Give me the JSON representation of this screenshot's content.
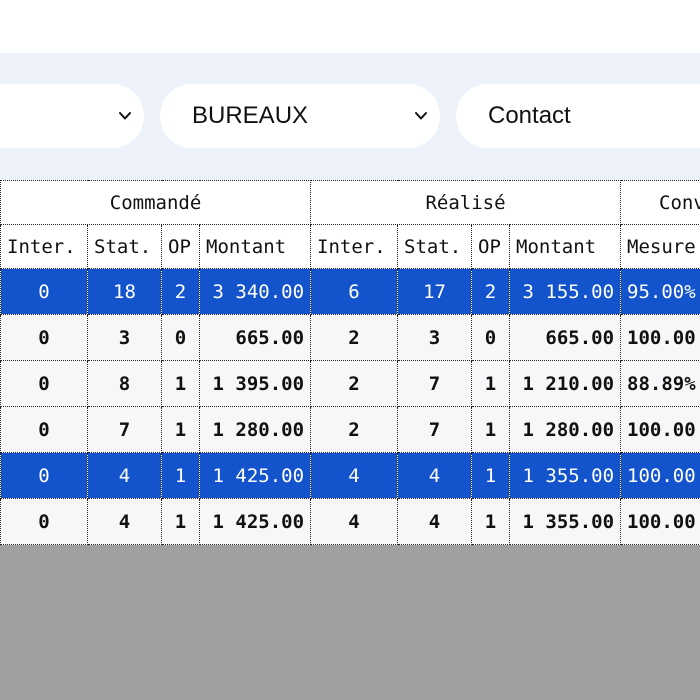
{
  "filters": {
    "first": {
      "value": ""
    },
    "second": {
      "value": "BUREAUX"
    },
    "third": {
      "value": "Contact"
    }
  },
  "table": {
    "groups": [
      "Commandé",
      "Réalisé",
      "Conv"
    ],
    "subheaders": [
      "Inter.",
      "Stat.",
      "OP",
      "Montant",
      "Inter.",
      "Stat.",
      "OP",
      "Montant",
      "Mesure"
    ],
    "rows": [
      {
        "selected": true,
        "cells": [
          "0",
          "18",
          "2",
          "3 340.00",
          "6",
          "17",
          "2",
          "3 155.00",
          "95.00%"
        ]
      },
      {
        "selected": false,
        "cells": [
          "0",
          "3",
          "0",
          "665.00",
          "2",
          "3",
          "0",
          "665.00",
          "100.00"
        ]
      },
      {
        "selected": false,
        "cells": [
          "0",
          "8",
          "1",
          "1 395.00",
          "2",
          "7",
          "1",
          "1 210.00",
          "88.89%"
        ]
      },
      {
        "selected": false,
        "cells": [
          "0",
          "7",
          "1",
          "1 280.00",
          "2",
          "7",
          "1",
          "1 280.00",
          "100.00"
        ]
      },
      {
        "selected": true,
        "cells": [
          "0",
          "4",
          "1",
          "1 425.00",
          "4",
          "4",
          "1",
          "1 355.00",
          "100.00"
        ]
      },
      {
        "selected": false,
        "cells": [
          "0",
          "4",
          "1",
          "1 425.00",
          "4",
          "4",
          "1",
          "1 355.00",
          "100.00"
        ]
      }
    ]
  },
  "colors": {
    "selected_row": "#1354cc",
    "filter_bar": "#edf1fa",
    "empty_area": "#a0a0a0"
  },
  "icons": {
    "dropdown": "chevron-down-icon"
  }
}
